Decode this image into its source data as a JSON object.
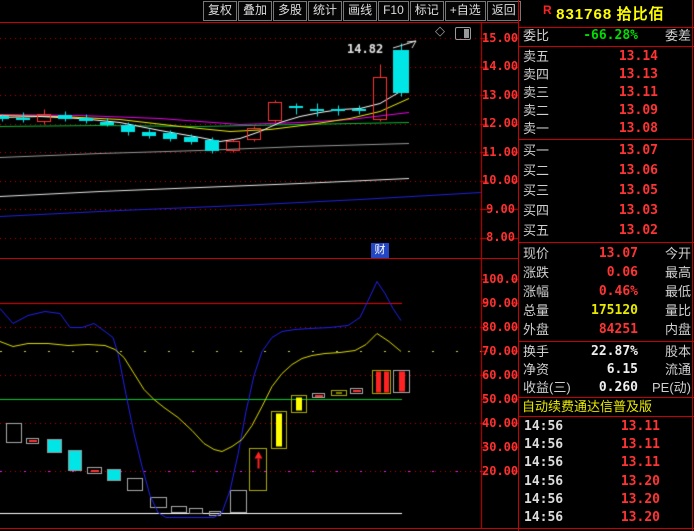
{
  "toolbar": {
    "buttons": [
      "复权",
      "叠加",
      "多股",
      "统计",
      "画线",
      "F10",
      "标记",
      "+自选",
      "返回"
    ]
  },
  "stock": {
    "flag": "R",
    "code": "831768",
    "name": "拾比佰"
  },
  "colors": {
    "up": "#ff3434",
    "down": "#00e6e6",
    "axis_red": "#ff3030",
    "border_red": "#c80000",
    "label_gray": "#cfcfcf",
    "value_yellow": "#e8e800",
    "green": "#00dd00",
    "badge_blue": "#2346c4"
  },
  "chart": {
    "badge": "财",
    "annotation": {
      "text": "14.82"
    },
    "main": {
      "y_ticks": [
        "15.00",
        "14.00",
        "13.00",
        "12.00",
        "11.00",
        "10.00",
        "9.00",
        "8.00"
      ],
      "grid": [
        15,
        14,
        13,
        12,
        11,
        10,
        9,
        8
      ],
      "candles": [
        [
          2,
          12.25,
          12.35,
          12.1,
          12.15,
          "d"
        ],
        [
          23,
          12.2,
          12.4,
          12.05,
          12.12,
          "d"
        ],
        [
          44,
          12.1,
          12.5,
          12.0,
          12.35,
          "u"
        ],
        [
          65,
          12.3,
          12.45,
          12.08,
          12.15,
          "d"
        ],
        [
          86,
          12.18,
          12.32,
          12.02,
          12.1,
          "d"
        ],
        [
          107,
          12.05,
          12.2,
          11.9,
          11.95,
          "d"
        ],
        [
          128,
          11.95,
          12.05,
          11.6,
          11.7,
          "d"
        ],
        [
          149,
          11.7,
          11.82,
          11.48,
          11.55,
          "d"
        ],
        [
          170,
          11.67,
          11.78,
          11.4,
          11.46,
          "d"
        ],
        [
          191,
          11.53,
          11.64,
          11.28,
          11.35,
          "d"
        ],
        [
          212,
          11.42,
          11.52,
          10.95,
          11.02,
          "d"
        ],
        [
          233,
          11.07,
          11.45,
          11.0,
          11.39,
          "u"
        ],
        [
          254,
          11.46,
          11.92,
          11.4,
          11.84,
          "u"
        ],
        [
          275,
          12.12,
          12.82,
          12.05,
          12.75,
          "u"
        ],
        [
          296,
          12.6,
          12.72,
          12.35,
          12.55,
          "d"
        ],
        [
          317,
          12.5,
          12.72,
          12.28,
          12.48,
          "d"
        ],
        [
          338,
          12.5,
          12.64,
          12.3,
          12.45,
          "d"
        ],
        [
          359,
          12.52,
          12.66,
          12.34,
          12.5,
          "d"
        ],
        [
          380,
          12.15,
          14.1,
          12.08,
          13.64,
          "u"
        ],
        [
          401,
          14.58,
          14.82,
          12.95,
          13.07,
          "d",
          16
        ]
      ],
      "ma_lines": [
        {
          "color": "#2222dd",
          "points": [
            [
              0,
              8.75
            ],
            [
              120,
              8.95
            ],
            [
              240,
              9.15
            ],
            [
              360,
              9.35
            ],
            [
              481,
              9.58
            ]
          ]
        },
        {
          "color": "#e8e8e8",
          "points": [
            [
              0,
              9.45
            ],
            [
              100,
              9.62
            ],
            [
              200,
              9.78
            ],
            [
              300,
              9.92
            ],
            [
              409,
              10.08
            ]
          ]
        },
        {
          "color": "#999999",
          "points": [
            [
              0,
              10.82
            ],
            [
              100,
              10.95
            ],
            [
              200,
              11.08
            ],
            [
              300,
              11.2
            ],
            [
              409,
              11.32
            ]
          ]
        },
        {
          "color": "#00bb33",
          "points": [
            [
              0,
              11.92
            ],
            [
              100,
              11.95
            ],
            [
              200,
              11.9
            ],
            [
              300,
              11.98
            ],
            [
              409,
              12.07
            ]
          ]
        },
        {
          "color": "#ee00ee",
          "points": [
            [
              0,
              12.35
            ],
            [
              80,
              12.3
            ],
            [
              160,
              12.18
            ],
            [
              240,
              12.0
            ],
            [
              300,
              12.05
            ],
            [
              350,
              12.15
            ],
            [
              409,
              12.42
            ]
          ]
        },
        {
          "color": "#eeee00",
          "points": [
            [
              0,
              12.3
            ],
            [
              60,
              12.28
            ],
            [
              120,
              12.15
            ],
            [
              180,
              11.92
            ],
            [
              230,
              11.72
            ],
            [
              270,
              11.82
            ],
            [
              310,
              12.0
            ],
            [
              350,
              12.2
            ],
            [
              380,
              12.45
            ],
            [
              409,
              12.9
            ]
          ]
        },
        {
          "color": "#ffffff",
          "points": [
            [
              0,
              12.22
            ],
            [
              40,
              12.25
            ],
            [
              80,
              12.2
            ],
            [
              120,
              12.05
            ],
            [
              160,
              11.78
            ],
            [
              200,
              11.52
            ],
            [
              220,
              11.38
            ],
            [
              240,
              11.48
            ],
            [
              260,
              11.72
            ],
            [
              280,
              12.05
            ],
            [
              300,
              12.28
            ],
            [
              320,
              12.42
            ],
            [
              340,
              12.5
            ],
            [
              360,
              12.55
            ],
            [
              380,
              12.72
            ],
            [
              409,
              13.3
            ]
          ]
        }
      ]
    },
    "sub": {
      "y_ticks": [
        "100.0",
        "90.00",
        "80.00",
        "70.00",
        "60.00",
        "50.00",
        "40.00",
        "30.00",
        "20.00"
      ],
      "grid": [
        100,
        90,
        80,
        70,
        60,
        50,
        40,
        30,
        20
      ],
      "ref_lines": [
        {
          "v": 90,
          "c": "#ee0000",
          "s": "solid"
        },
        {
          "v": 80,
          "c": "#c40000",
          "s": "dot"
        },
        {
          "v": 70,
          "c": "#cccc55",
          "s": "sparse"
        },
        {
          "v": 60,
          "c": "#c40000",
          "s": "dot"
        },
        {
          "v": 50,
          "c": "#00cc33",
          "s": "solid"
        },
        {
          "v": 40,
          "c": "#c40000",
          "s": "dot"
        },
        {
          "v": 20,
          "c": "#c40000",
          "s": "dot"
        },
        {
          "v": 20,
          "c": "#ee22ee",
          "s": "sparse"
        },
        {
          "v": 2.5,
          "c": "#ffffff",
          "s": "solid"
        }
      ],
      "boxes": [
        [
          6,
          22,
          40,
          32,
          "g"
        ],
        [
          26,
          39,
          33.8,
          31.7,
          "d"
        ],
        [
          47,
          62,
          33.3,
          27.9,
          "c"
        ],
        [
          68,
          82,
          28.8,
          20.4,
          "c"
        ],
        [
          87,
          102,
          21.7,
          19.2,
          "d"
        ],
        [
          107,
          121,
          20.8,
          16.3,
          "c"
        ],
        [
          127,
          143,
          17.1,
          12.1,
          "g"
        ],
        [
          150,
          167,
          9.2,
          5.0,
          "g"
        ],
        [
          171,
          187,
          5.4,
          2.9,
          "g"
        ],
        [
          189,
          203,
          4.6,
          2.5,
          "g"
        ],
        [
          209,
          221,
          3.3,
          1.7,
          "g"
        ],
        [
          230,
          247,
          12.1,
          2.9,
          "g"
        ],
        [
          249,
          267,
          29.6,
          12.1,
          "a"
        ],
        [
          271,
          287,
          45.0,
          29.6,
          "y"
        ],
        [
          291,
          307,
          51.7,
          44.6,
          "y"
        ],
        [
          312,
          325,
          52.5,
          50.8,
          "d"
        ],
        [
          331,
          347,
          53.8,
          51.7,
          "y"
        ],
        [
          350,
          363,
          54.6,
          52.5,
          "d"
        ],
        [
          372,
          391,
          62.1,
          52.5,
          "r"
        ],
        [
          393,
          410,
          62.1,
          52.9,
          "rg"
        ]
      ],
      "lines": [
        {
          "color": "#2222ee",
          "points": [
            [
              0,
              88
            ],
            [
              13,
              81.5
            ],
            [
              28,
              85
            ],
            [
              45,
              86.5
            ],
            [
              60,
              86
            ],
            [
              70,
              80
            ],
            [
              82,
              80
            ],
            [
              94,
              81.5
            ],
            [
              105,
              78.5
            ],
            [
              113,
              76
            ],
            [
              118,
              69
            ],
            [
              126,
              52
            ],
            [
              134,
              36
            ],
            [
              142,
              22
            ],
            [
              150,
              10
            ],
            [
              158,
              3
            ],
            [
              166,
              0.8
            ],
            [
              214,
              0.8
            ],
            [
              222,
              3
            ],
            [
              230,
              12
            ],
            [
              238,
              27
            ],
            [
              246,
              45
            ],
            [
              254,
              60
            ],
            [
              262,
              70
            ],
            [
              272,
              76
            ],
            [
              282,
              78.5
            ],
            [
              295,
              79
            ],
            [
              310,
              79.5
            ],
            [
              330,
              80
            ],
            [
              348,
              81
            ],
            [
              360,
              84
            ],
            [
              370,
              93
            ],
            [
              377,
              99
            ],
            [
              385,
              94
            ],
            [
              393,
              88
            ],
            [
              401,
              83
            ]
          ]
        },
        {
          "color": "#dddd00",
          "points": [
            [
              0,
              74
            ],
            [
              13,
              72
            ],
            [
              28,
              73.5
            ],
            [
              48,
              73.5
            ],
            [
              68,
              72.5
            ],
            [
              88,
              73
            ],
            [
              105,
              72.5
            ],
            [
              115,
              71
            ],
            [
              124,
              67.5
            ],
            [
              134,
              61
            ],
            [
              144,
              54
            ],
            [
              154,
              50
            ],
            [
              164,
              46.5
            ],
            [
              178,
              42.5
            ],
            [
              192,
              37
            ],
            [
              204,
              31.5
            ],
            [
              214,
              29
            ],
            [
              222,
              28.2
            ],
            [
              232,
              30.5
            ],
            [
              242,
              33.5
            ],
            [
              252,
              39
            ],
            [
              262,
              47
            ],
            [
              272,
              55.5
            ],
            [
              282,
              61
            ],
            [
              292,
              64.5
            ],
            [
              302,
              67
            ],
            [
              312,
              68.5
            ],
            [
              325,
              69
            ],
            [
              340,
              69.5
            ],
            [
              355,
              70.5
            ],
            [
              366,
              73
            ],
            [
              377,
              77.5
            ],
            [
              389,
              74
            ],
            [
              401,
              69.8
            ]
          ]
        }
      ]
    }
  },
  "quote": {
    "header": {
      "label": "委比",
      "value": "-66.28%",
      "right_label": "委差",
      "color": "green"
    },
    "asks": [
      {
        "label": "卖五",
        "price": "13.14"
      },
      {
        "label": "卖四",
        "price": "13.13"
      },
      {
        "label": "卖三",
        "price": "13.11"
      },
      {
        "label": "卖二",
        "price": "13.09"
      },
      {
        "label": "卖一",
        "price": "13.08"
      }
    ],
    "bids": [
      {
        "label": "买一",
        "price": "13.07"
      },
      {
        "label": "买二",
        "price": "13.06"
      },
      {
        "label": "买三",
        "price": "13.05"
      },
      {
        "label": "买四",
        "price": "13.03"
      },
      {
        "label": "买五",
        "price": "13.02"
      }
    ],
    "stats": [
      {
        "label": "现价",
        "value": "13.07",
        "right_label": "今开",
        "color": "red"
      },
      {
        "label": "涨跌",
        "value": "0.06",
        "right_label": "最高",
        "color": "red"
      },
      {
        "label": "涨幅",
        "value": "0.46%",
        "right_label": "最低",
        "color": "red"
      },
      {
        "label": "总量",
        "value": "175120",
        "right_label": "量比",
        "color": "yellow"
      },
      {
        "label": "外盘",
        "value": "84251",
        "right_label": "内盘",
        "color": "red"
      }
    ],
    "stats2": [
      {
        "label": "换手",
        "value": "22.87%",
        "right_label": "股本",
        "color": "white"
      },
      {
        "label": "净资",
        "value": "6.15",
        "right_label": "流通",
        "color": "white"
      },
      {
        "label": "收益(三)",
        "value": "0.260",
        "right_label": "PE(动)",
        "color": "white"
      }
    ],
    "ad": "自动续费通达信普及版",
    "ticks": [
      {
        "time": "14:56",
        "price": "13.11"
      },
      {
        "time": "14:56",
        "price": "13.11"
      },
      {
        "time": "14:56",
        "price": "13.11"
      },
      {
        "time": "14:56",
        "price": "13.20"
      },
      {
        "time": "14:56",
        "price": "13.20"
      },
      {
        "time": "14:56",
        "price": "13.20"
      }
    ]
  }
}
